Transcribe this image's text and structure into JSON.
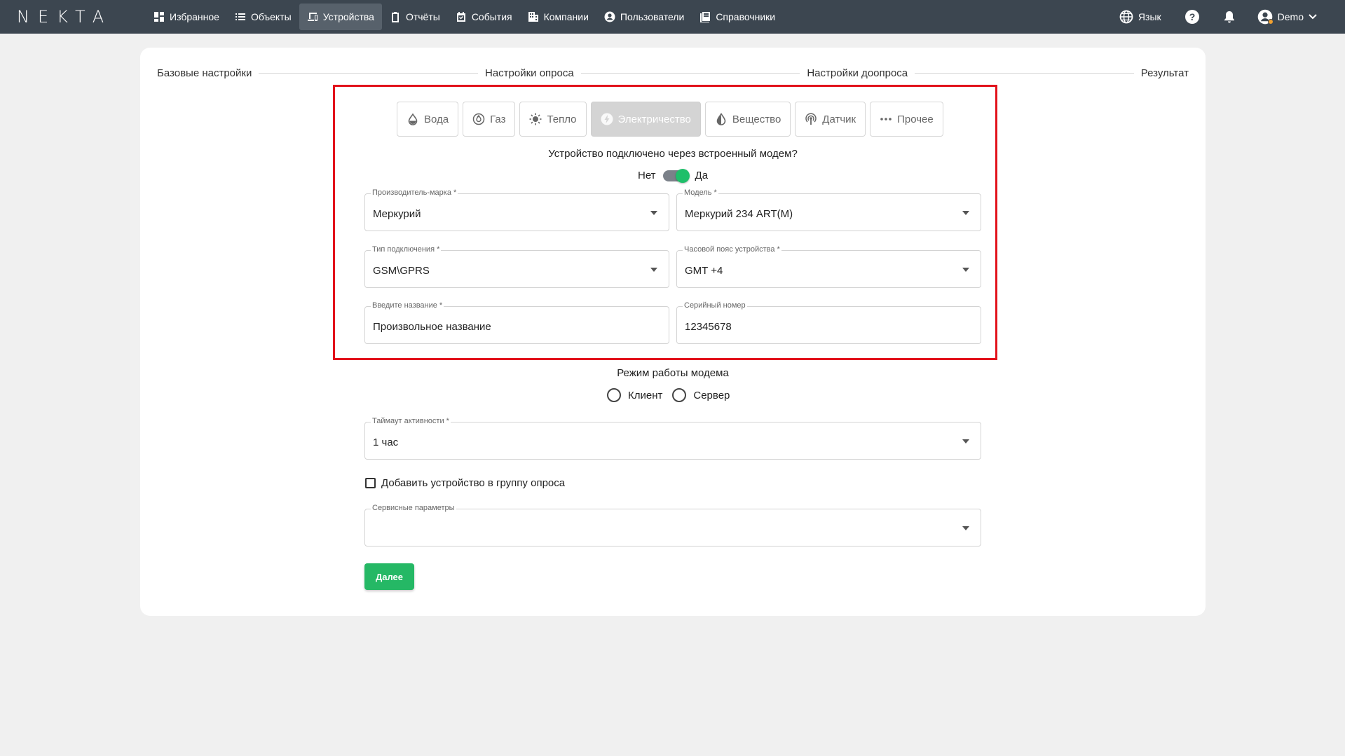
{
  "app": {
    "logo_text": "NEKTA"
  },
  "nav": {
    "items": [
      {
        "label": "Избранное",
        "icon": "dashboard-icon"
      },
      {
        "label": "Объекты",
        "icon": "list-icon"
      },
      {
        "label": "Устройства",
        "icon": "devices-icon",
        "active": true
      },
      {
        "label": "Отчёты",
        "icon": "clipboard-icon"
      },
      {
        "label": "События",
        "icon": "calendar-check-icon"
      },
      {
        "label": "Компании",
        "icon": "building-icon"
      },
      {
        "label": "Пользователи",
        "icon": "user-circle-icon"
      },
      {
        "label": "Справочники",
        "icon": "book-icon"
      }
    ],
    "language_label": "Язык",
    "user_label": "Demo"
  },
  "stepper": {
    "steps": [
      "Базовые настройки",
      "Настройки опроса",
      "Настройки доопроса",
      "Результат"
    ]
  },
  "categories": [
    {
      "label": "Вода",
      "icon": "water-drop-icon"
    },
    {
      "label": "Газ",
      "icon": "gas-flame-icon"
    },
    {
      "label": "Тепло",
      "icon": "sun-icon"
    },
    {
      "label": "Электричество",
      "icon": "lightning-icon",
      "active": true
    },
    {
      "label": "Вещество",
      "icon": "contrast-drop-icon"
    },
    {
      "label": "Датчик",
      "icon": "antenna-icon"
    },
    {
      "label": "Прочее",
      "icon": "more-dots-icon"
    }
  ],
  "modem": {
    "question": "Устройство подключено через встроенный модем?",
    "no_label": "Нет",
    "yes_label": "Да",
    "enabled": true
  },
  "fields": {
    "manufacturer": {
      "label": "Производитель-марка *",
      "value": "Меркурий"
    },
    "model": {
      "label": "Модель *",
      "value": "Меркурий 234 ART(M)"
    },
    "connection_type": {
      "label": "Тип подключения *",
      "value": "GSM\\GPRS"
    },
    "timezone": {
      "label": "Часовой пояс устройства *",
      "value": "GMT +4"
    },
    "name": {
      "label": "Введите название *",
      "value": "Произвольное название"
    },
    "serial": {
      "label": "Серийный номер",
      "value": "12345678"
    },
    "timeout": {
      "label": "Таймаут активности *",
      "value": "1 час"
    },
    "service": {
      "label": "Сервисные параметры",
      "value": ""
    }
  },
  "modem_mode": {
    "title": "Режим работы модема",
    "options": [
      "Клиент",
      "Сервер"
    ]
  },
  "group_checkbox_label": "Добавить устройство в группу опроса",
  "next_button": "Далее",
  "colors": {
    "topbar": "#3c4650",
    "accent": "#25b865",
    "highlight": "#e2121b"
  }
}
